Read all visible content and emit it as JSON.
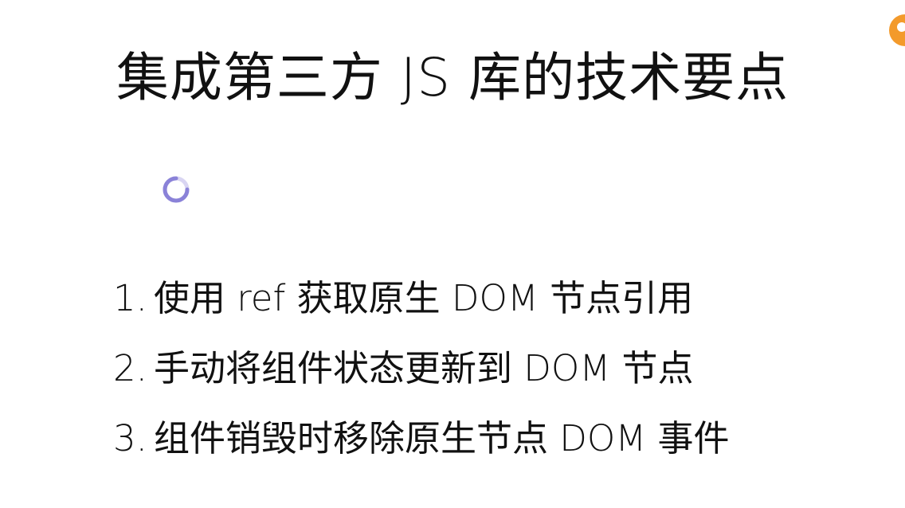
{
  "slide": {
    "title": "集成第三方 JS 库的技术要点",
    "points": [
      {
        "number": "1.",
        "text": "使用 ref 获取原生 DOM 节点引用"
      },
      {
        "number": "2.",
        "text": "手动将组件状态更新到 DOM 节点"
      },
      {
        "number": "3.",
        "text": "组件销毁时移除原生节点 DOM 事件"
      }
    ]
  },
  "colors": {
    "background": "#ffffff",
    "text": "#111111",
    "cursor": "#8a82d8",
    "badge": "#f39a2b"
  },
  "icons": {
    "cursor": "loading-cursor-icon",
    "badge": "orange-circle-icon"
  }
}
